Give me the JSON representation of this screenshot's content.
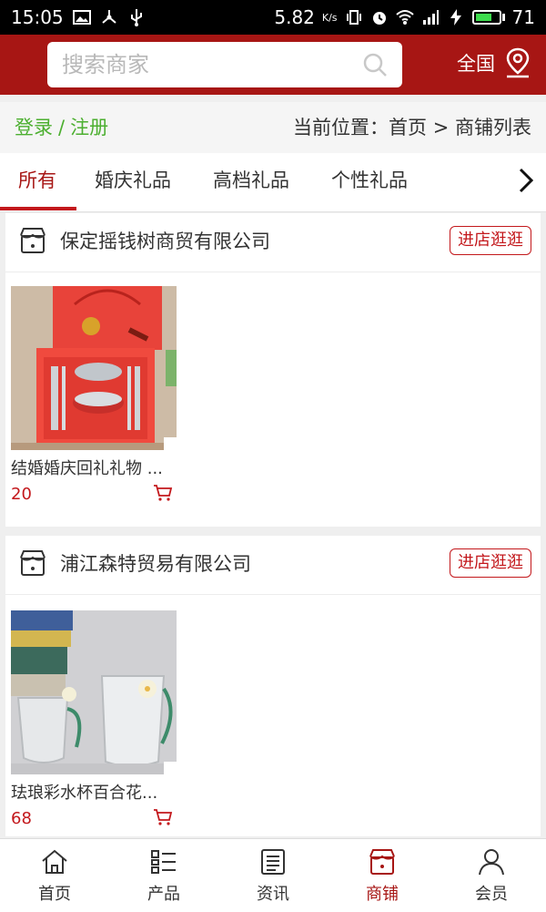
{
  "status_bar": {
    "time": "15:05",
    "network_speed": "5.82",
    "network_unit": "K/s",
    "battery": "71",
    "battery_level": 0.71
  },
  "header": {
    "search_placeholder": "搜索商家",
    "region": "全国"
  },
  "crumb_bar": {
    "login": "登录",
    "separator": "/",
    "register": "注册",
    "location": "当前位置：首页 > 商铺列表"
  },
  "tabs": [
    {
      "label": "所有",
      "active": true
    },
    {
      "label": "婚庆礼品",
      "active": false
    },
    {
      "label": "高档礼品",
      "active": false
    },
    {
      "label": "个性礼品",
      "active": false
    }
  ],
  "shops": [
    {
      "name": "保定摇钱树商贸有限公司",
      "button": "进店逛逛",
      "product": {
        "name": "结婚婚庆回礼礼物 ...",
        "price": "20"
      }
    },
    {
      "name": "浦江森特贸易有限公司",
      "button": "进店逛逛",
      "product": {
        "name": "珐琅彩水杯百合花...",
        "price": "68"
      }
    }
  ],
  "bottom_nav": [
    {
      "label": "首页",
      "icon": "home-icon",
      "active": false
    },
    {
      "label": "产品",
      "icon": "list-icon",
      "active": false
    },
    {
      "label": "资讯",
      "icon": "news-icon",
      "active": false
    },
    {
      "label": "商铺",
      "icon": "shop-icon",
      "active": true
    },
    {
      "label": "会员",
      "icon": "user-icon",
      "active": false
    }
  ],
  "colors": {
    "brand": "#a71614",
    "accent": "#c3181c",
    "login_green": "#4caf30"
  }
}
